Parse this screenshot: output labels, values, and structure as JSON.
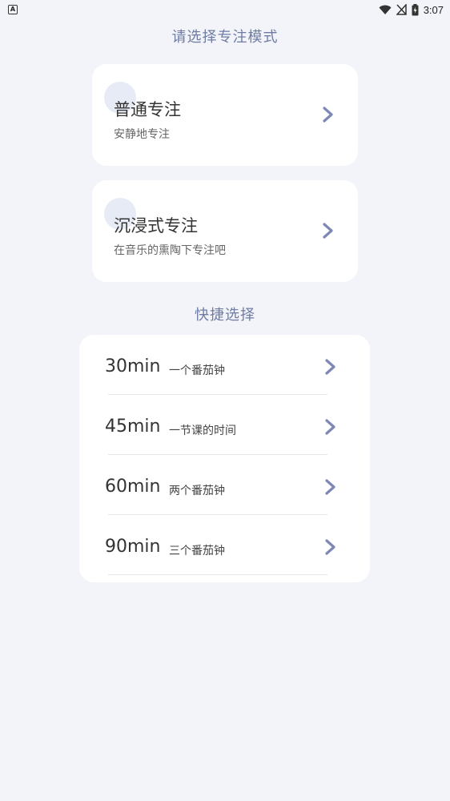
{
  "status_bar": {
    "app_badge": "A",
    "time": "3:07",
    "icons": [
      "wifi-icon",
      "no-signal-icon",
      "battery-charging-icon"
    ]
  },
  "header": {
    "title": "请选择专注模式"
  },
  "modes": [
    {
      "title": "普通专注",
      "subtitle": "安静地专注",
      "icon": "chevron-right-icon"
    },
    {
      "title": "沉浸式专注",
      "subtitle": "在音乐的熏陶下专注吧",
      "icon": "chevron-right-icon"
    }
  ],
  "quick": {
    "title": "快捷选择",
    "items": [
      {
        "time": "30min",
        "desc": "一个番茄钟"
      },
      {
        "time": "45min",
        "desc": "一节课的时间"
      },
      {
        "time": "60min",
        "desc": "两个番茄钟"
      },
      {
        "time": "90min",
        "desc": "三个番茄钟"
      }
    ]
  },
  "colors": {
    "accent": "#6f7ba3",
    "chevron": "#7d88b5",
    "background": "#f2f4f9",
    "card": "#ffffff"
  }
}
